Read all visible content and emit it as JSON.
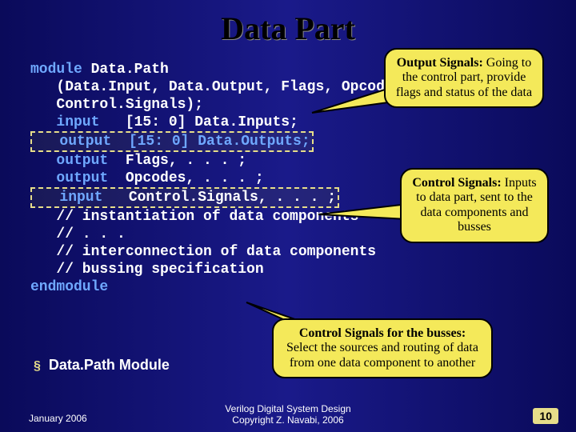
{
  "title": "Data Part",
  "code": {
    "kw_module": "module",
    "module_name": " Data.Path",
    "params1": "   (Data.Input, Data.Output, Flags, Opcodes,",
    "params2": "   Control.Signals);",
    "blank": "",
    "l_input1_kw": "   input",
    "l_input1_rest": "   [15: 0] Data.Inputs;",
    "l_output1": "   output  [15: 0] Data.Outputs;",
    "l_output2_kw": "   output",
    "l_output2_rest": "  Flags, . . . ;",
    "l_output3_kw": "   output",
    "l_output3_rest": "  Opcodes, . . . ;",
    "l_input2_kw": "   input",
    "l_input2_rest": "   Control.Signals, . . . ;",
    "c1": "   // instantiation of data components",
    "c2": "   // . . .",
    "c3": "   // interconnection of data components",
    "c4": "   // bussing specification",
    "kw_endmodule": "endmodule"
  },
  "bullet": {
    "marker": "§",
    "text": "Data.Path Module"
  },
  "callouts": {
    "out": {
      "title": "Output Signals:",
      "rest": " Going to the control part, provide flags and status of the data"
    },
    "ctrl": {
      "title": "Control Signals:",
      "rest": " Inputs to data part, sent to the data components and busses"
    },
    "bus": {
      "title": "Control Signals for the busses:",
      "rest": " Select the sources and routing of data from one data component to another"
    }
  },
  "footer": {
    "date": "January 2006",
    "center1": "Verilog Digital System Design",
    "center2": "Copyright Z. Navabi, 2006",
    "page": "10"
  }
}
